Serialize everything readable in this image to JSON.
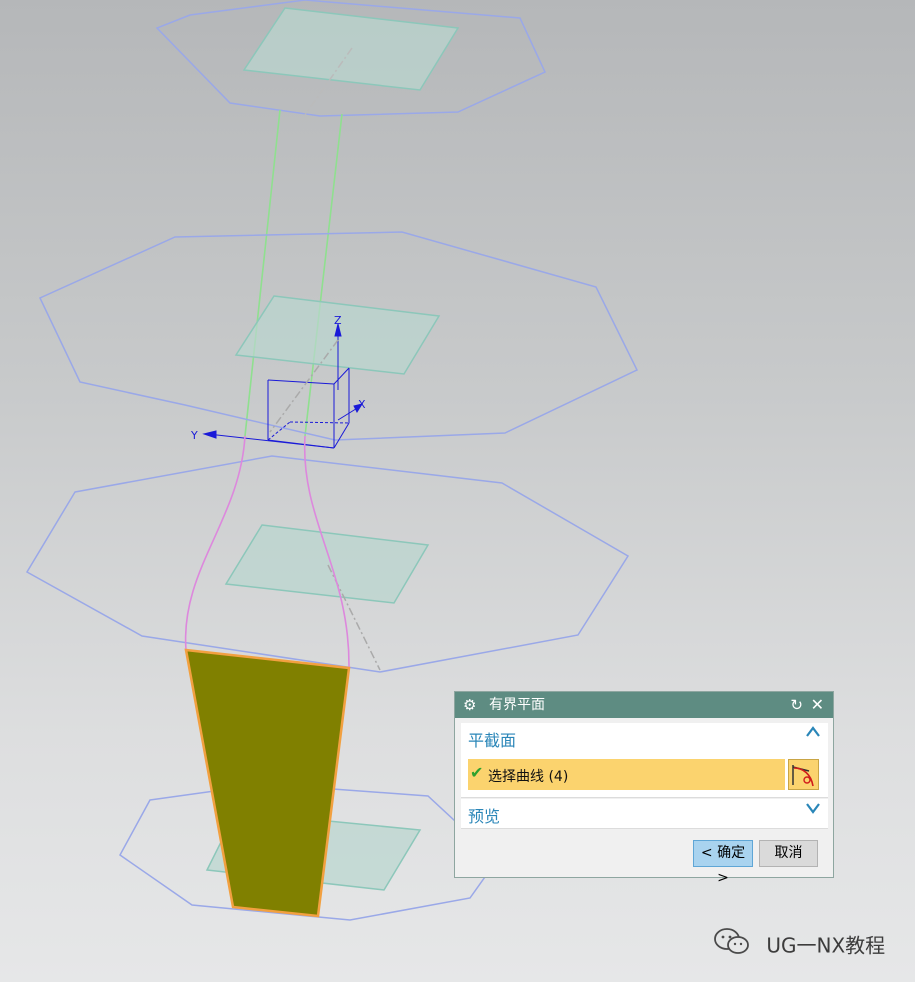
{
  "viewport": {
    "axis_labels": {
      "x": "X",
      "y": "Y",
      "z": "Z"
    },
    "surface_color": "#808000",
    "edge_color": "#f2a040",
    "curve_color": "#dd88dd",
    "line_color": "#8fe08f",
    "outline_color": "#9aa8e8",
    "plane_color": "#b9d6cf",
    "csys_color": "#1a1ad8"
  },
  "dialog": {
    "title": "有界平面",
    "sections": {
      "plane_section": {
        "label": "平截面",
        "select_label": "选择曲线 (4)",
        "expanded": true
      },
      "preview_section": {
        "label": "预览",
        "expanded": false
      }
    },
    "buttons": {
      "ok_label": "< 确定 >",
      "cancel_label": "取消"
    }
  },
  "watermark": {
    "text": "UG一NX教程"
  }
}
